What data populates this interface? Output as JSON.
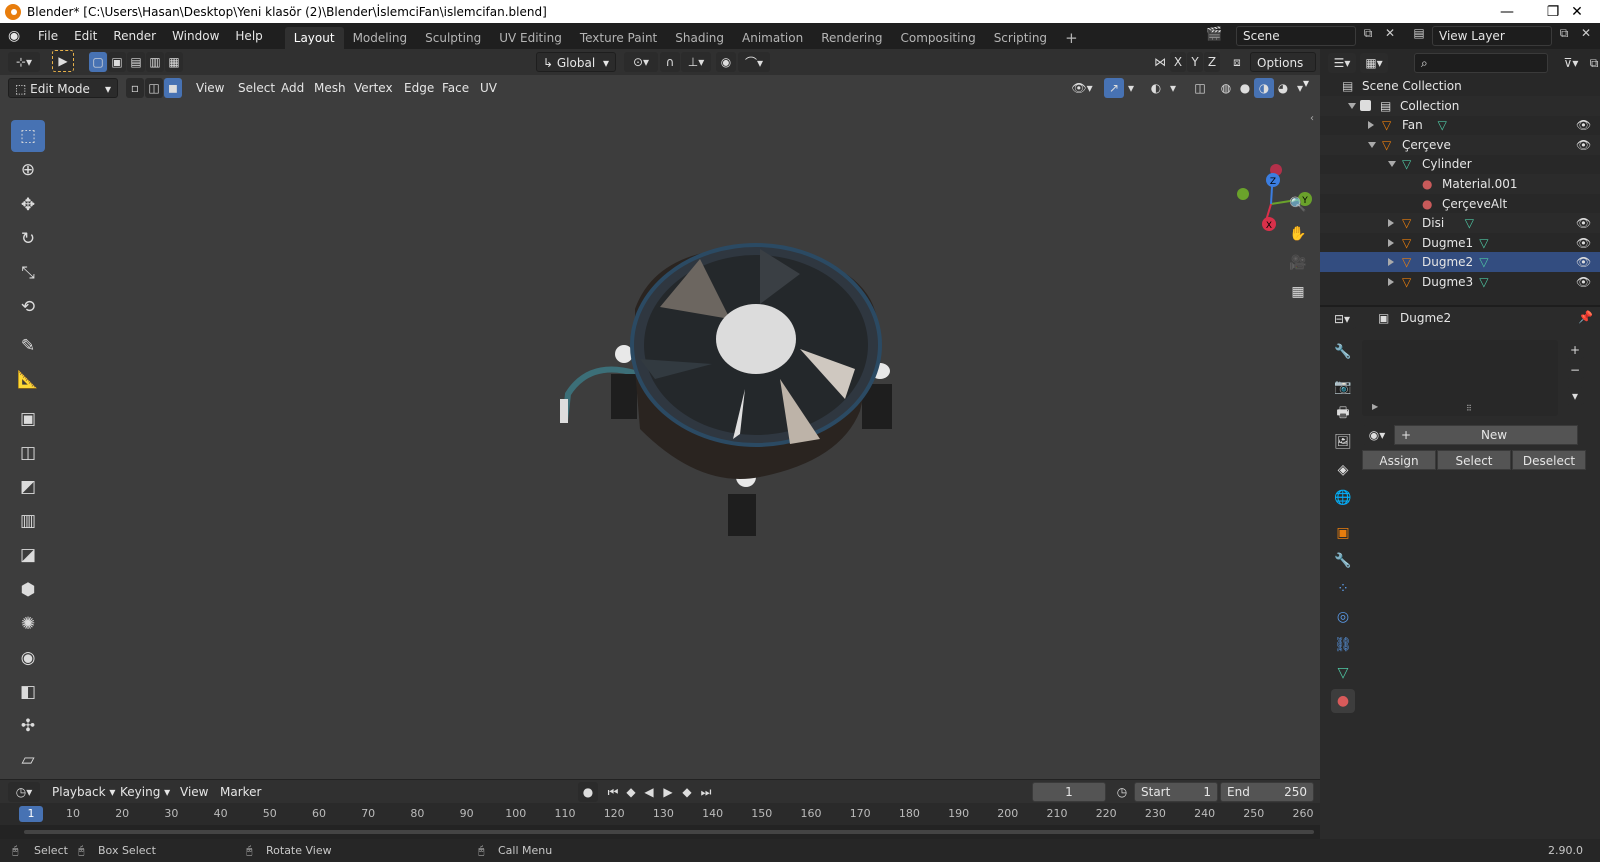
{
  "window": {
    "title": "Blender* [C:\\Users\\Hasan\\Desktop\\Yeni klasör (2)\\Blender\\İslemciFan\\islemcifan.blend]",
    "minimize": "—",
    "maximize": "❐",
    "close": "✕"
  },
  "menus": [
    "File",
    "Edit",
    "Render",
    "Window",
    "Help"
  ],
  "workspaces": [
    "Layout",
    "Modeling",
    "Sculpting",
    "UV Editing",
    "Texture Paint",
    "Shading",
    "Animation",
    "Rendering",
    "Compositing",
    "Scripting"
  ],
  "workspace_add": "+",
  "scene": {
    "name": "Scene",
    "view_layer": "View Layer"
  },
  "viewport": {
    "orientation": "Global",
    "options_label": "Options",
    "axes": [
      "X",
      "Y",
      "Z"
    ],
    "mode": "Edit Mode",
    "menu": [
      "View",
      "Select",
      "Add",
      "Mesh",
      "Vertex",
      "Edge",
      "Face",
      "UV"
    ],
    "gizmo": {
      "x": "X",
      "y": "Y",
      "z": "Z"
    }
  },
  "tools": [
    {
      "name": "select-box-tool",
      "icon": "⬚"
    },
    {
      "name": "cursor-tool",
      "icon": "⊕"
    },
    {
      "name": "move-tool",
      "icon": "✥"
    },
    {
      "name": "rotate-tool",
      "icon": "↻"
    },
    {
      "name": "scale-tool",
      "icon": "⤡"
    },
    {
      "name": "transform-tool",
      "icon": "⟲"
    },
    {
      "name": "annotate-tool",
      "icon": "✎"
    },
    {
      "name": "measure-tool",
      "icon": "📐"
    },
    {
      "name": "extrude-tool",
      "icon": "▣"
    },
    {
      "name": "inset-tool",
      "icon": "◫"
    },
    {
      "name": "bevel-tool",
      "icon": "◩"
    },
    {
      "name": "loop-cut-tool",
      "icon": "▥"
    },
    {
      "name": "knife-tool",
      "icon": "◪"
    },
    {
      "name": "poly-build-tool",
      "icon": "⬢"
    },
    {
      "name": "spin-tool",
      "icon": "✺"
    },
    {
      "name": "smooth-tool",
      "icon": "◉"
    },
    {
      "name": "edge-slide-tool",
      "icon": "◧"
    },
    {
      "name": "shrink-fatten-tool",
      "icon": "✣"
    },
    {
      "name": "shear-tool",
      "icon": "▱"
    }
  ],
  "timeline": {
    "menus": [
      "Playback",
      "Keying",
      "View",
      "Marker"
    ],
    "current_frame": "1",
    "start_label": "Start",
    "start": "1",
    "end_label": "End",
    "end": "250",
    "ticks": [
      "1",
      "10",
      "20",
      "30",
      "40",
      "50",
      "60",
      "70",
      "80",
      "90",
      "100",
      "110",
      "120",
      "130",
      "140",
      "150",
      "160",
      "170",
      "180",
      "190",
      "200",
      "210",
      "220",
      "230",
      "240",
      "250",
      "260"
    ]
  },
  "status": {
    "select": "Select",
    "box_select": "Box Select",
    "rotate_view": "Rotate View",
    "call_menu": "Call Menu",
    "version": "2.90.0"
  },
  "outliner": {
    "rows": [
      {
        "label": "Scene Collection",
        "type": "scene"
      },
      {
        "label": "Collection",
        "type": "collection"
      },
      {
        "label": "Fan",
        "type": "object"
      },
      {
        "label": "Çerçeve",
        "type": "object"
      },
      {
        "label": "Cylinder",
        "type": "mesh"
      },
      {
        "label": "Material.001",
        "type": "material"
      },
      {
        "label": "ÇerçeveAlt",
        "type": "material"
      },
      {
        "label": "Disi",
        "type": "object"
      },
      {
        "label": "Dugme1",
        "type": "object"
      },
      {
        "label": "Dugme2",
        "type": "object"
      },
      {
        "label": "Dugme3",
        "type": "object"
      }
    ]
  },
  "properties": {
    "object_name": "Dugme2",
    "new_label": "New",
    "assign_label": "Assign",
    "select_label": "Select",
    "deselect_label": "Deselect"
  },
  "colors": {
    "accent": "#4772b3",
    "viewport_bg": "#3d3d3d",
    "object_orange": "#e87d0d",
    "mesh_green": "#4fc6a3",
    "material_red": "#c85a5a"
  }
}
